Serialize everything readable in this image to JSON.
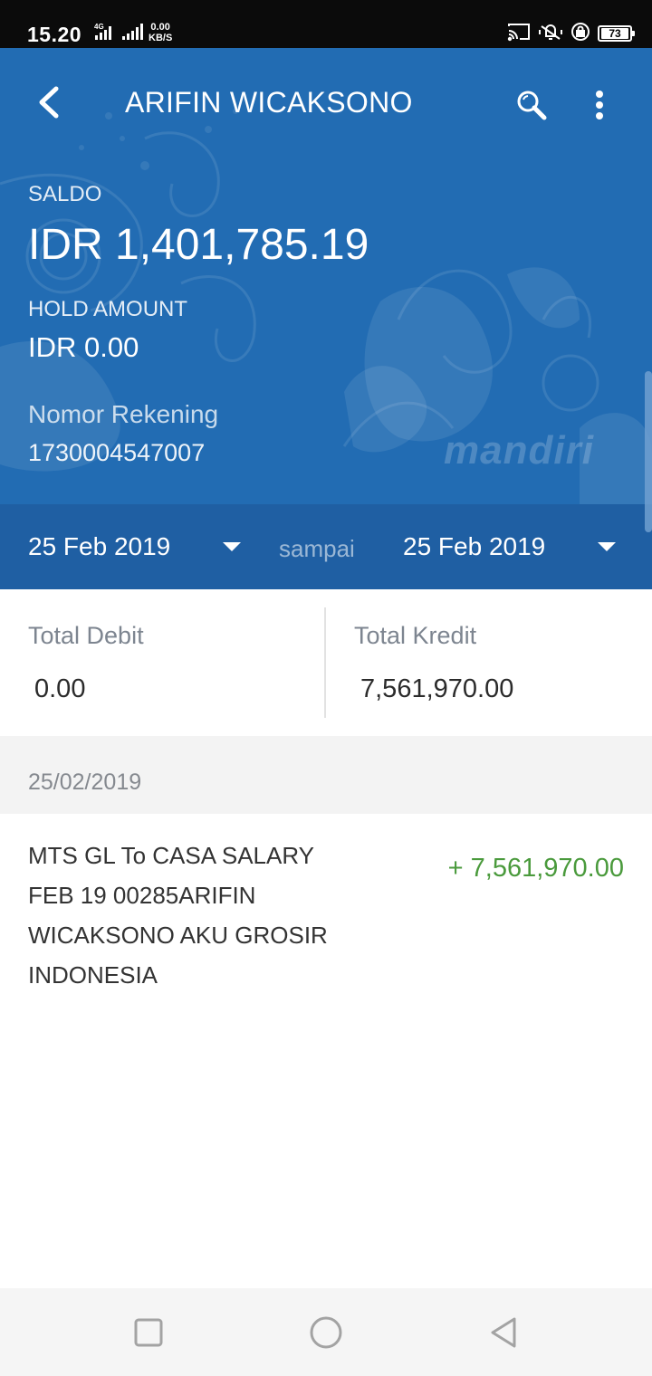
{
  "status_bar": {
    "time": "15.20",
    "network": "4G",
    "speed_value": "0.00",
    "speed_unit": "KB/S",
    "battery": "73"
  },
  "header": {
    "title": "ARIFIN WICAKSONO",
    "brand_watermark": "mandiri",
    "icons": {
      "back": "back-arrow-icon",
      "search": "search-icon",
      "more": "more-vert-icon"
    }
  },
  "account": {
    "saldo_label": "SALDO",
    "saldo_value": "IDR 1,401,785.19",
    "hold_label": "HOLD AMOUNT",
    "hold_value": "IDR 0.00",
    "account_number_label": "Nomor Rekening",
    "account_number": "1730004547007"
  },
  "date_filter": {
    "from": "25 Feb 2019",
    "separator": "sampai",
    "to": "25 Feb 2019"
  },
  "totals": {
    "debit_label": "Total Debit",
    "debit_value": "0.00",
    "credit_label": "Total Kredit",
    "credit_value": "7,561,970.00"
  },
  "transactions": [
    {
      "date": "25/02/2019",
      "description": "MTS GL To CASA SALARY FEB 19 00285ARIFIN WICAKSONO AKU GROSIR INDONESIA",
      "amount": "+ 7,561,970.00"
    }
  ],
  "colors": {
    "header_blue": "#226cb3",
    "datebar_blue": "#1f5fa3",
    "credit_green": "#4a9a3c"
  }
}
